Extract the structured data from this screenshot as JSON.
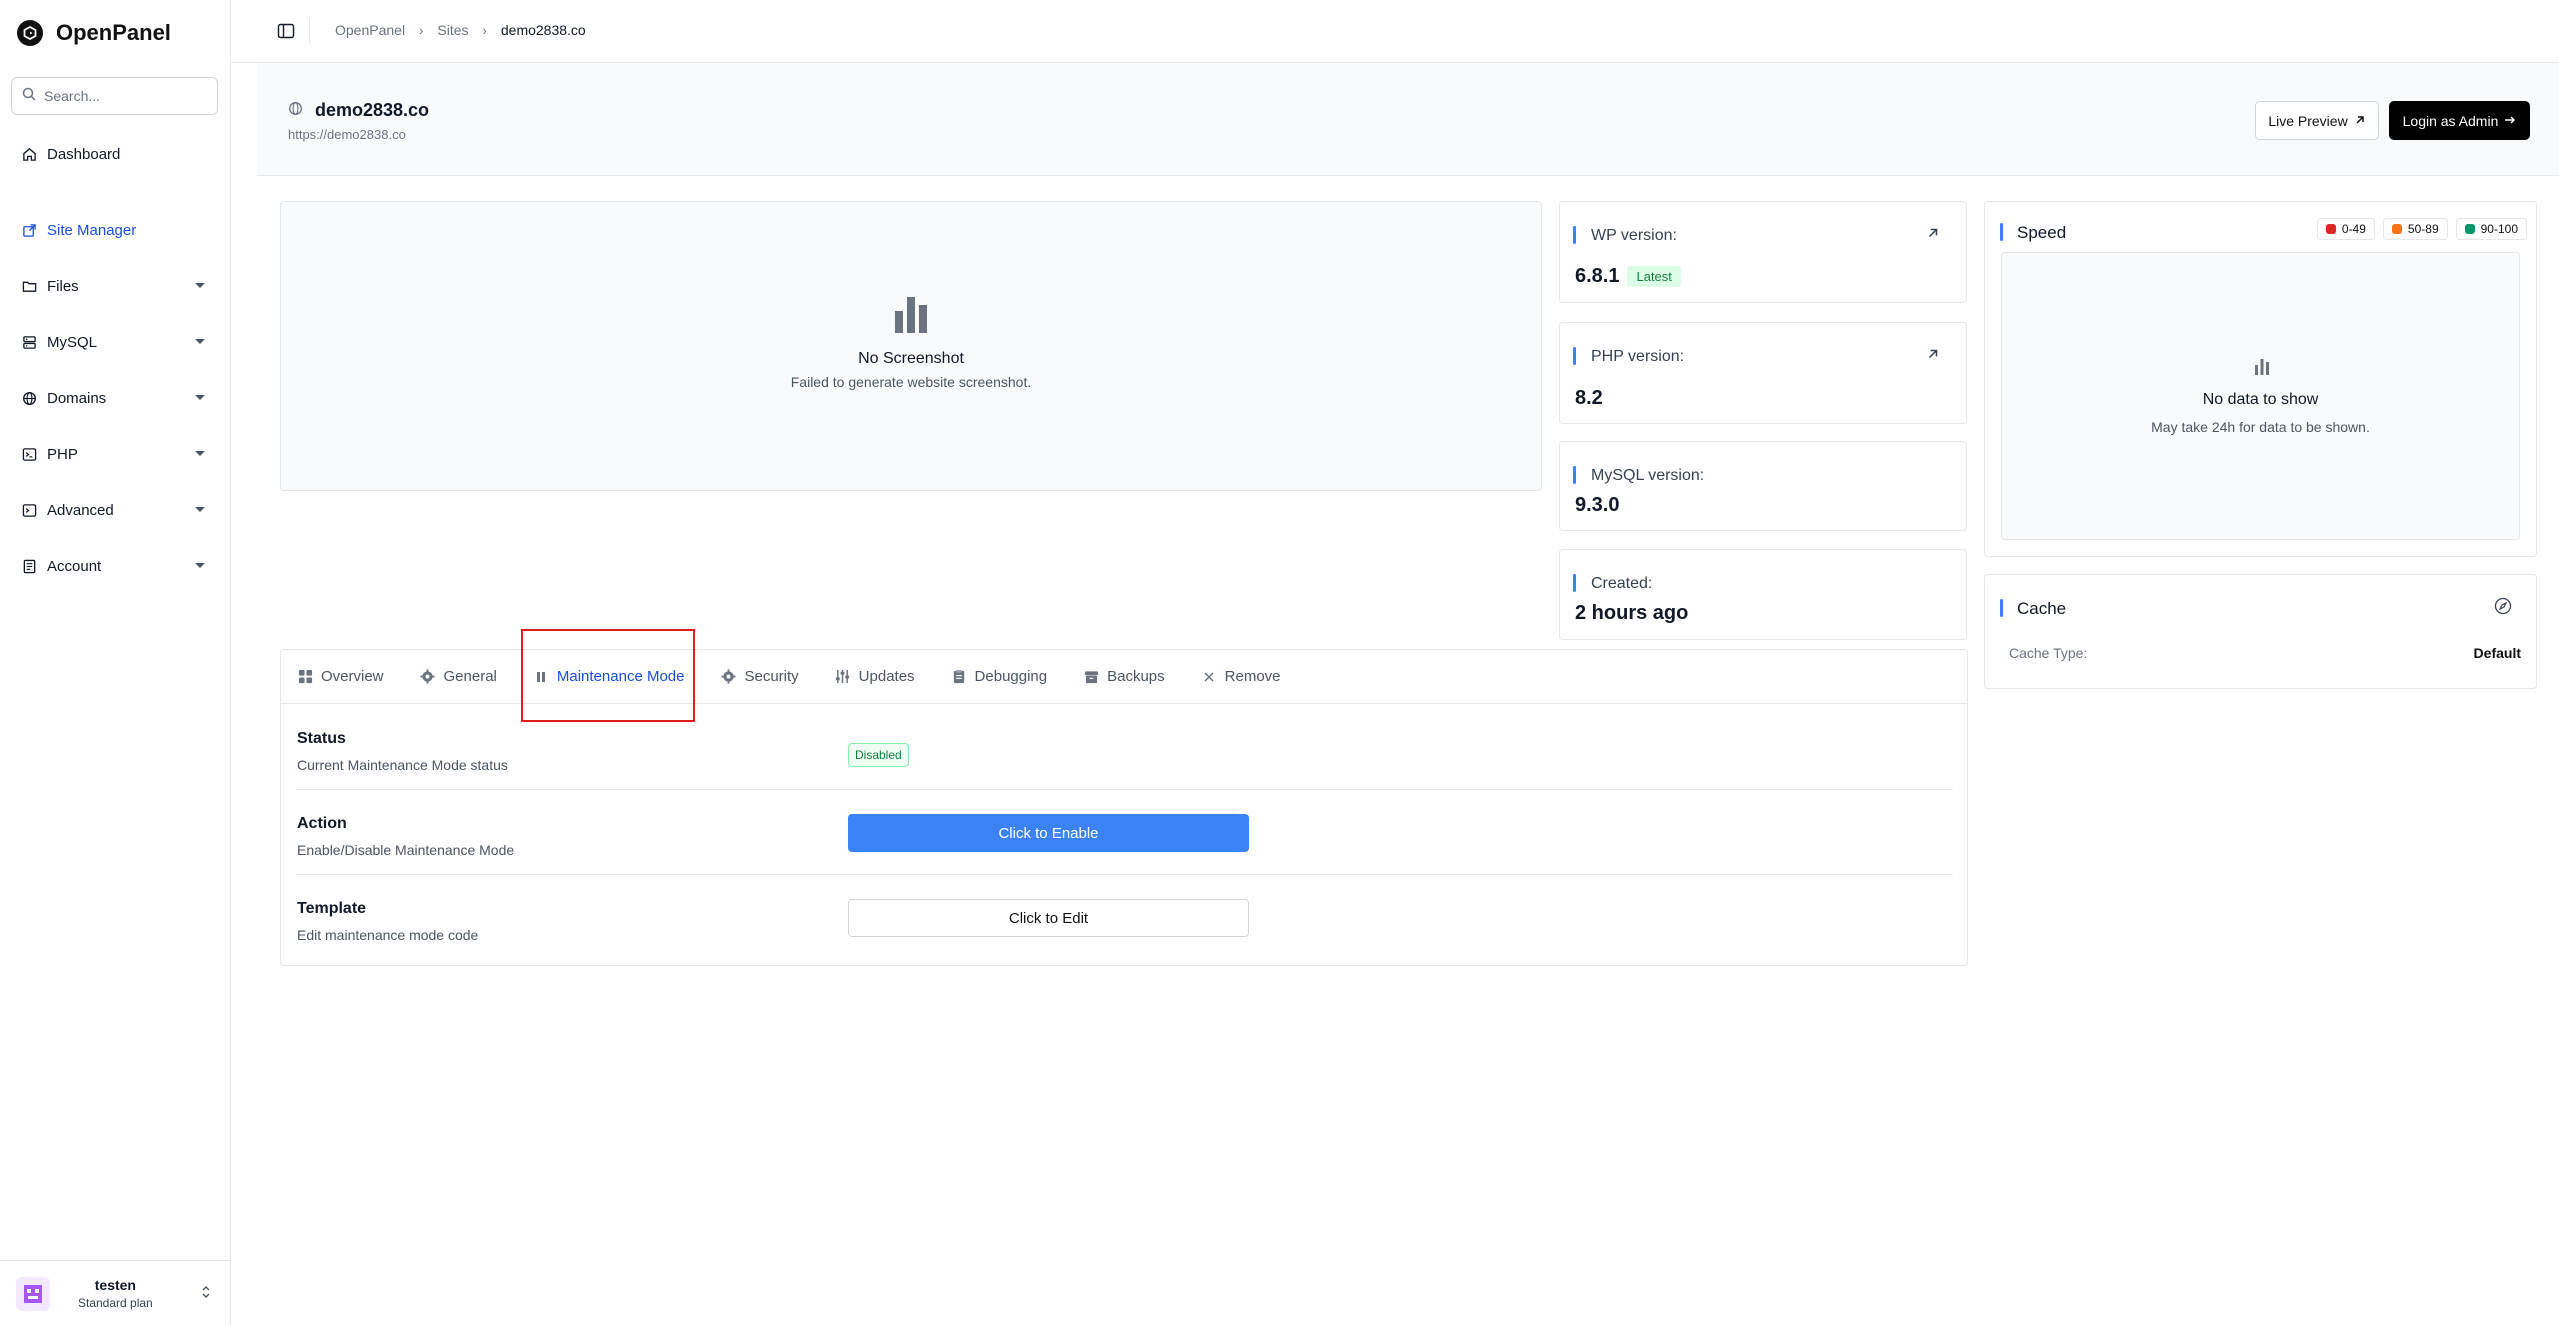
{
  "brand": {
    "name": "OpenPanel"
  },
  "search": {
    "placeholder": "Search..."
  },
  "sidebar": {
    "items": [
      {
        "label": "Dashboard",
        "icon": "home-icon"
      },
      {
        "label": "Site Manager",
        "icon": "external-link-icon",
        "active": true
      },
      {
        "label": "Files",
        "icon": "folder-icon"
      },
      {
        "label": "MySQL",
        "icon": "database-icon"
      },
      {
        "label": "Domains",
        "icon": "globe-icon"
      },
      {
        "label": "PHP",
        "icon": "terminal-icon"
      },
      {
        "label": "Advanced",
        "icon": "terminal-icon"
      },
      {
        "label": "Account",
        "icon": "document-icon"
      }
    ]
  },
  "user": {
    "name": "testen",
    "plan": "Standard plan"
  },
  "breadcrumb": [
    "OpenPanel",
    "Sites",
    "demo2838.co"
  ],
  "site": {
    "title": "demo2838.co",
    "url": "https://demo2838.co",
    "live_preview_label": "Live Preview",
    "login_admin_label": "Login as Admin"
  },
  "screenshot": {
    "title": "No Screenshot",
    "subtitle": "Failed to generate website screenshot."
  },
  "info": {
    "wp": {
      "label": "WP version:",
      "value": "6.8.1",
      "badge": "Latest"
    },
    "php": {
      "label": "PHP version:",
      "value": "8.2"
    },
    "mysql": {
      "label": "MySQL version:",
      "value": "9.3.0"
    },
    "created": {
      "label": "Created:",
      "value": "2 hours ago"
    }
  },
  "speed": {
    "title": "Speed",
    "legend": [
      {
        "label": "0-49",
        "color": "#dc2626"
      },
      {
        "label": "50-89",
        "color": "#f97316"
      },
      {
        "label": "90-100",
        "color": "#059669"
      }
    ],
    "empty_title": "No data to show",
    "empty_subtitle": "May take 24h for data to be shown."
  },
  "cache": {
    "title": "Cache",
    "type_label": "Cache Type:",
    "type_value": "Default"
  },
  "tabs": [
    {
      "label": "Overview",
      "icon": "grid-icon"
    },
    {
      "label": "General",
      "icon": "gear-icon"
    },
    {
      "label": "Maintenance Mode",
      "icon": "pause-icon",
      "active": true
    },
    {
      "label": "Security",
      "icon": "gear-icon"
    },
    {
      "label": "Updates",
      "icon": "sliders-icon"
    },
    {
      "label": "Debugging",
      "icon": "clipboard-icon"
    },
    {
      "label": "Backups",
      "icon": "archive-icon"
    },
    {
      "label": "Remove",
      "icon": "close-icon"
    }
  ],
  "maintenance": {
    "status": {
      "title": "Status",
      "desc": "Current Maintenance Mode status",
      "badge": "Disabled"
    },
    "action": {
      "title": "Action",
      "desc": "Enable/Disable Maintenance Mode",
      "button": "Click to Enable"
    },
    "template": {
      "title": "Template",
      "desc": "Edit maintenance mode code",
      "button": "Click to Edit"
    }
  }
}
